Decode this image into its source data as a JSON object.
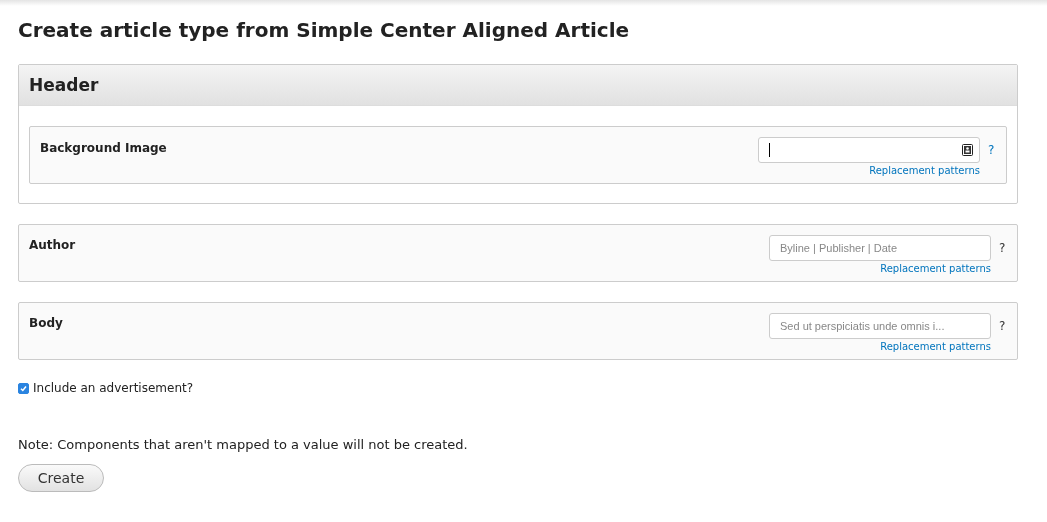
{
  "title": "Create article type from Simple Center Aligned Article",
  "groups": [
    {
      "title": "Header",
      "fields": [
        {
          "label": "Background Image",
          "kind": "image",
          "focused": true,
          "help": "?",
          "link": "Replacement patterns"
        }
      ]
    }
  ],
  "fields": [
    {
      "label": "Author",
      "focused": false,
      "placeholder": "Byline | Publisher | Date",
      "help": "?",
      "link": "Replacement patterns"
    },
    {
      "label": "Body",
      "focused": false,
      "placeholder": "Sed ut perspiciatis unde omnis i...",
      "help": "?",
      "link": "Replacement patterns"
    }
  ],
  "checkbox": {
    "label": "Include an advertisement?",
    "checked": true
  },
  "note": "Note: Components that aren't mapped to a value will not be created.",
  "button": "Create"
}
